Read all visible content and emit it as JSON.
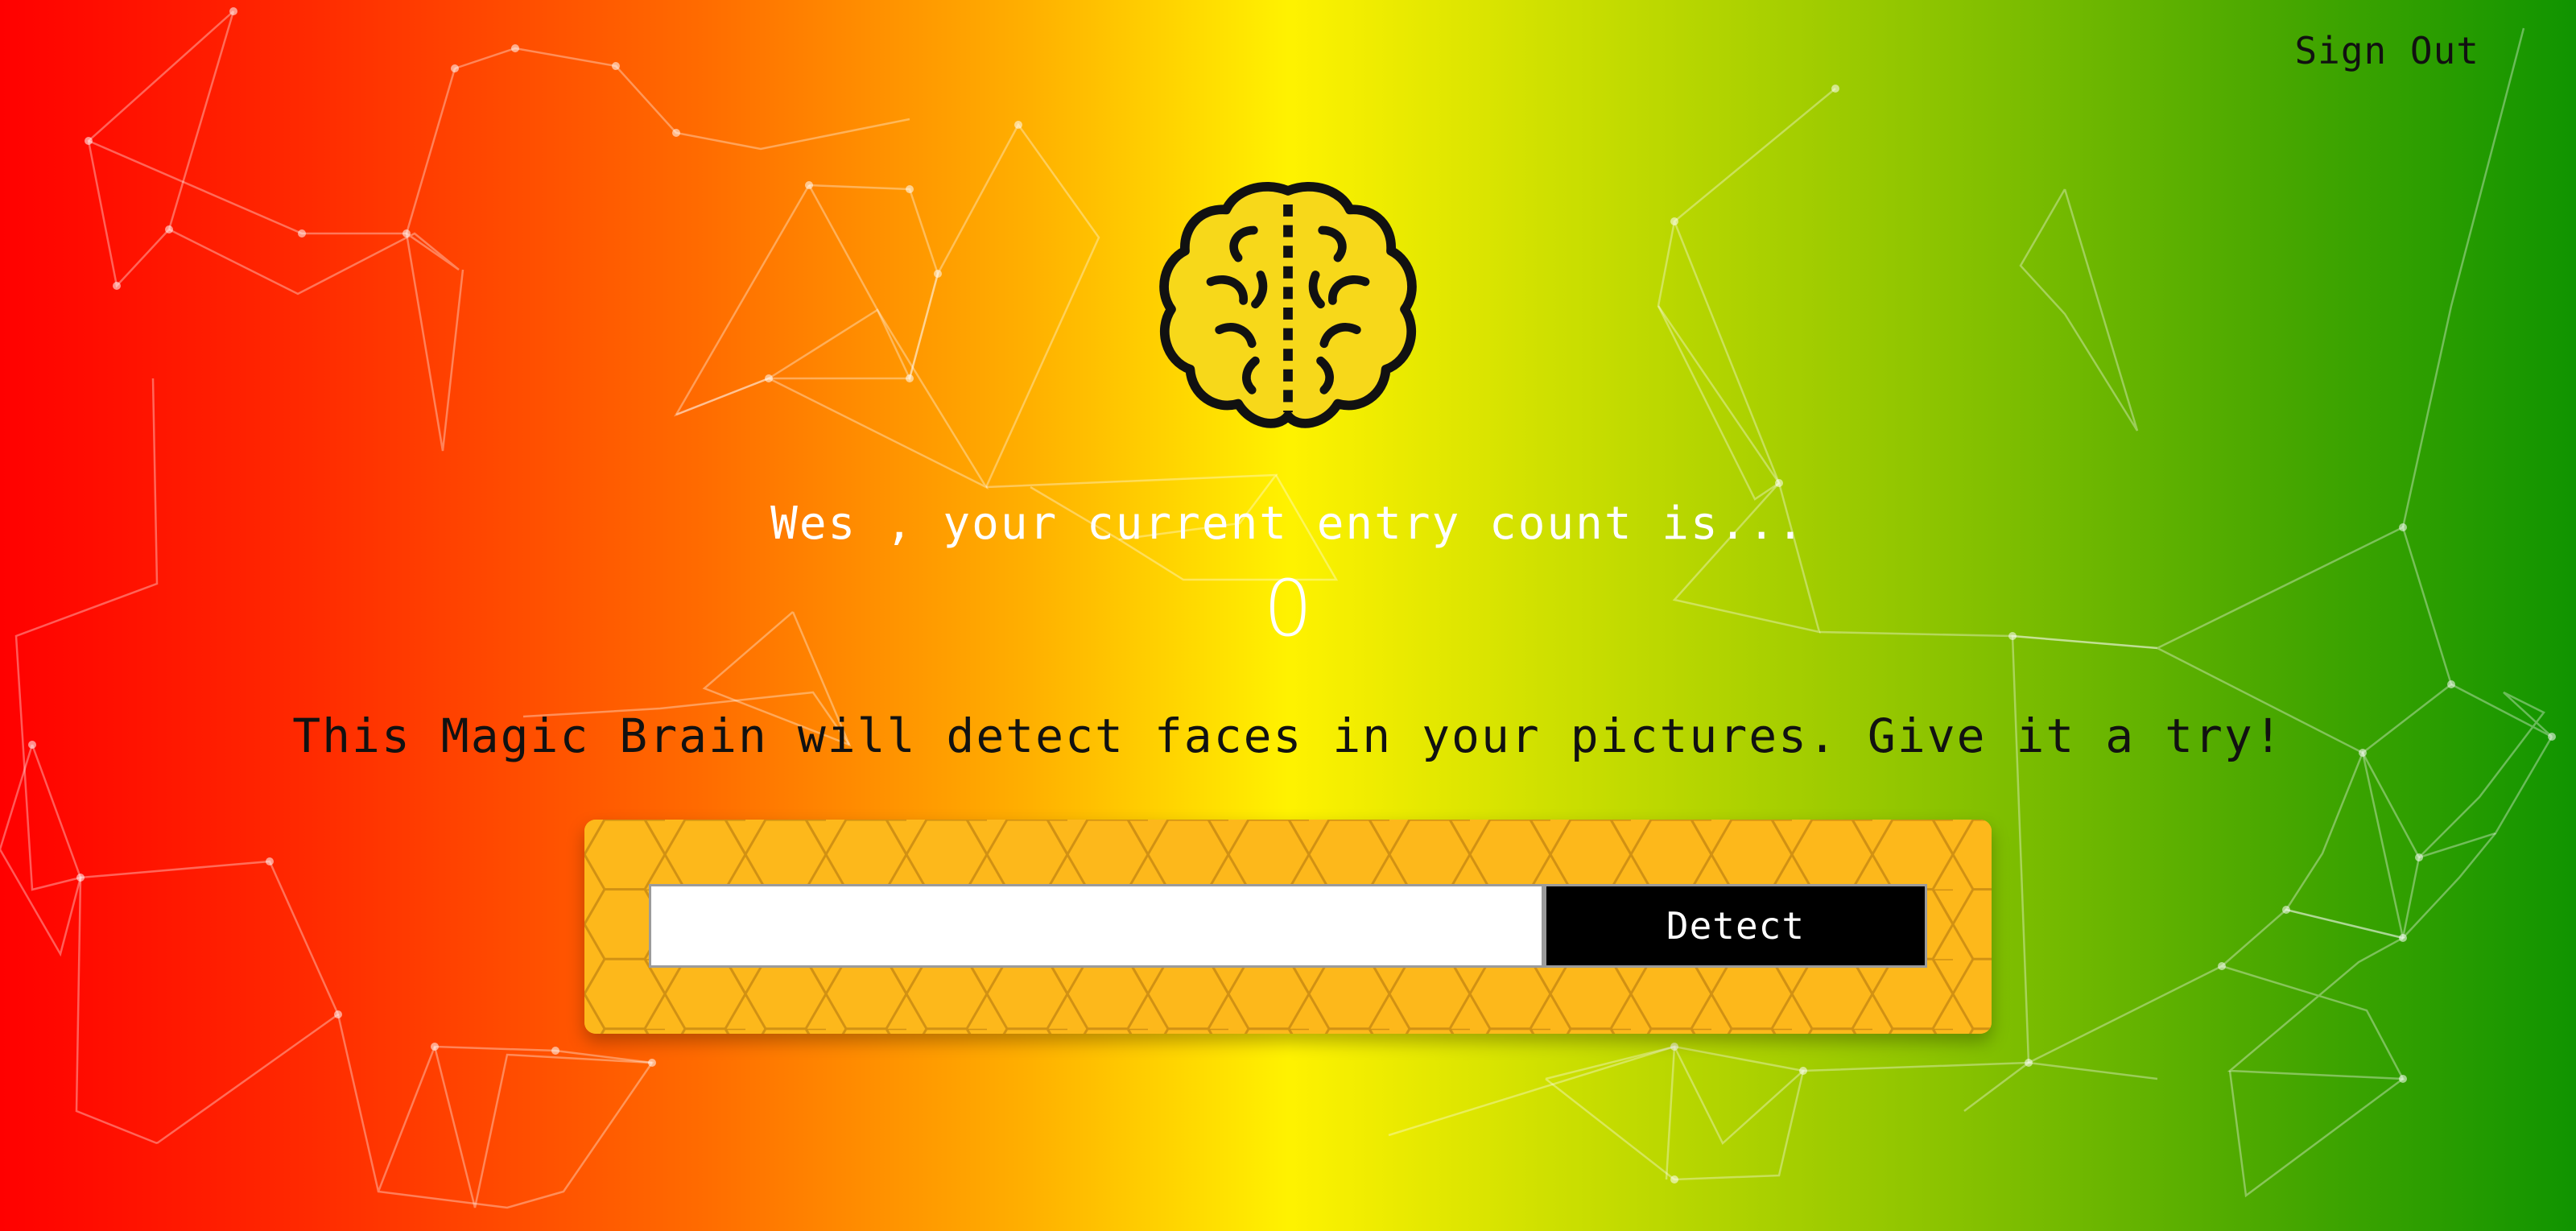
{
  "navigation": {
    "sign_out_label": "Sign Out"
  },
  "logo": {
    "icon": "brain-icon",
    "color": "#f7d81a",
    "stroke": "#111111"
  },
  "rank": {
    "user_name": "Wes",
    "message": "Wes , your current entry count is...",
    "entry_count": "0"
  },
  "image_link_form": {
    "description": "This Magic Brain will detect faces in your pictures. Give it a try!",
    "input_value": "",
    "input_placeholder": "",
    "button_label": "Detect"
  },
  "colors": {
    "gradient_left": "#ff0000",
    "gradient_middle": "#fff200",
    "gradient_right": "#109400",
    "panel": "#fdb81b",
    "button": "#000000"
  }
}
